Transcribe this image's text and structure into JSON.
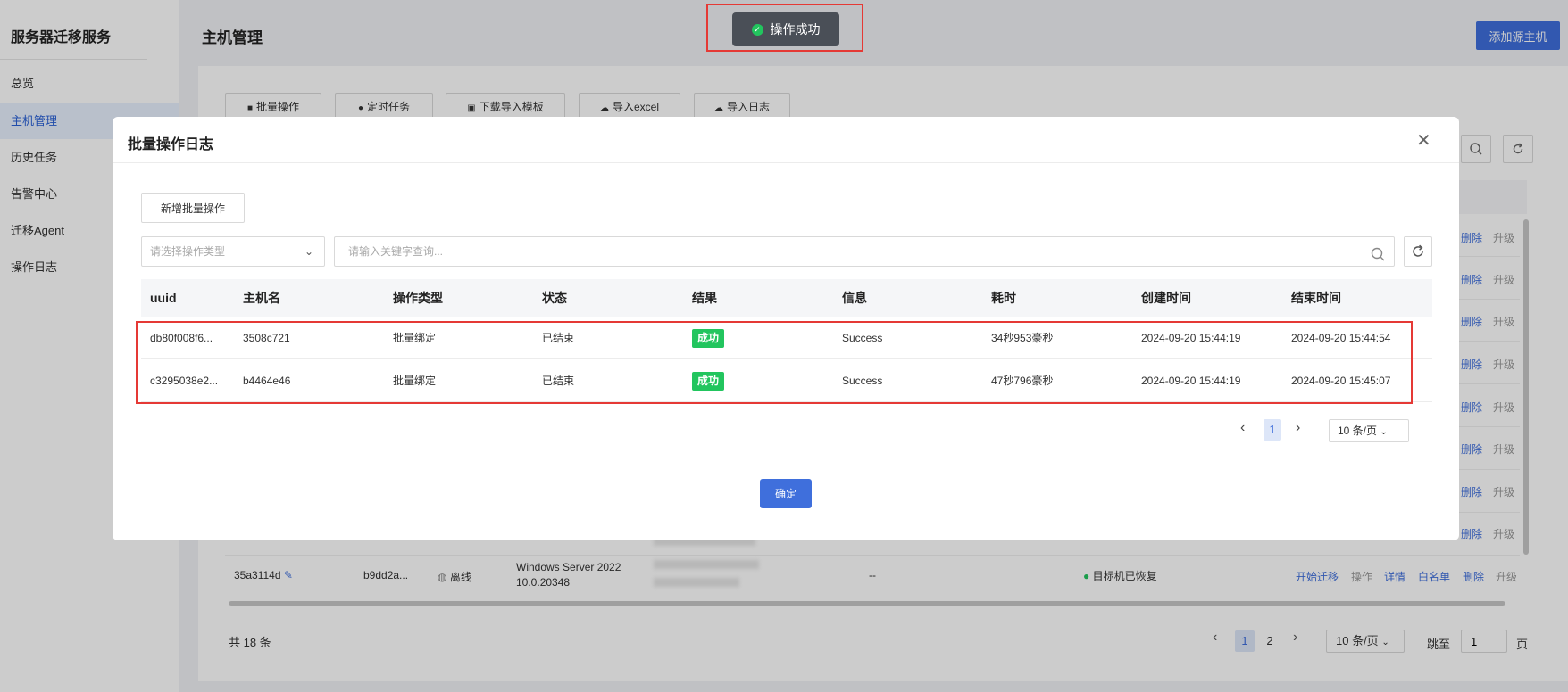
{
  "sidebar": {
    "title": "服务器迁移服务",
    "items": [
      {
        "label": "总览"
      },
      {
        "label": "主机管理"
      },
      {
        "label": "历史任务"
      },
      {
        "label": "告警中心"
      },
      {
        "label": "迁移Agent"
      },
      {
        "label": "操作日志"
      }
    ]
  },
  "header": {
    "title": "主机管理",
    "add_host_label": "添加源主机"
  },
  "toolbar": {
    "buttons": [
      {
        "label": "批量操作"
      },
      {
        "label": "定时任务"
      },
      {
        "label": "下载导入模板"
      },
      {
        "label": "导入excel"
      },
      {
        "label": "导入日志"
      }
    ]
  },
  "bg_table": {
    "row_delete_label": "删除",
    "row_upgrade_label": "升级",
    "last_row": {
      "id": "35a3114d",
      "host": "b9dd2a...",
      "status": "离线",
      "os_line1": "Windows Server 2022",
      "os_line2": "10.0.20348",
      "dash": "--",
      "recover": "目标机已恢复",
      "actions": [
        "开始迁移",
        "操作",
        "详情",
        "白名单",
        "删除",
        "升级"
      ]
    },
    "total": "共 18 条",
    "pages": [
      "1",
      "2"
    ],
    "page_size": "10 条/页",
    "goto_label": "跳至",
    "goto_value": "1",
    "page_unit": "页"
  },
  "toast": {
    "message": "操作成功"
  },
  "modal": {
    "title": "批量操作日志",
    "new_batch_label": "新增批量操作",
    "type_placeholder": "请选择操作类型",
    "search_placeholder": "请输入关键字查询...",
    "columns": [
      "uuid",
      "主机名",
      "操作类型",
      "状态",
      "结果",
      "信息",
      "耗时",
      "创建时间",
      "结束时间"
    ],
    "rows": [
      {
        "uuid": "db80f008f6...",
        "host": "3508c721",
        "type": "批量绑定",
        "state": "已结束",
        "result": "成功",
        "info": "Success",
        "duration": "34秒953豪秒",
        "created": "2024-09-20 15:44:19",
        "ended": "2024-09-20 15:44:54"
      },
      {
        "uuid": "c3295038e2...",
        "host": "b4464e46",
        "type": "批量绑定",
        "state": "已结束",
        "result": "成功",
        "info": "Success",
        "duration": "47秒796豪秒",
        "created": "2024-09-20 15:44:19",
        "ended": "2024-09-20 15:45:07"
      }
    ],
    "page": "1",
    "page_size": "10 条/页",
    "confirm_label": "确定"
  }
}
